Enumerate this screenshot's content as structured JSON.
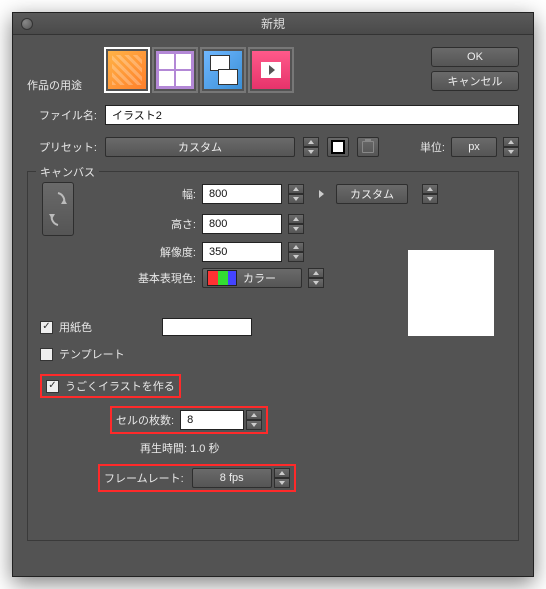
{
  "dialog": {
    "title": "新規",
    "ok_label": "OK",
    "cancel_label": "キャンセル"
  },
  "purpose": {
    "label": "作品の用途"
  },
  "filename": {
    "label": "ファイル名:",
    "value": "イラスト2"
  },
  "preset": {
    "label": "プリセット:",
    "value": "カスタム"
  },
  "unit": {
    "label": "単位:",
    "value": "px"
  },
  "canvas": {
    "legend": "キャンバス",
    "width_label": "幅:",
    "width_value": "800",
    "height_label": "高さ:",
    "height_value": "800",
    "resolution_label": "解像度:",
    "resolution_value": "350",
    "color_label": "基本表現色:",
    "color_value": "カラー",
    "custom_btn": "カスタム",
    "paper_color_label": "用紙色",
    "template_label": "テンプレート",
    "anim_label": "うごくイラストを作る",
    "frames_label": "セルの枚数:",
    "frames_value": "8",
    "playtime_label": "再生時間: 1.0 秒",
    "framerate_label": "フレームレート:",
    "framerate_value": "8 fps"
  }
}
